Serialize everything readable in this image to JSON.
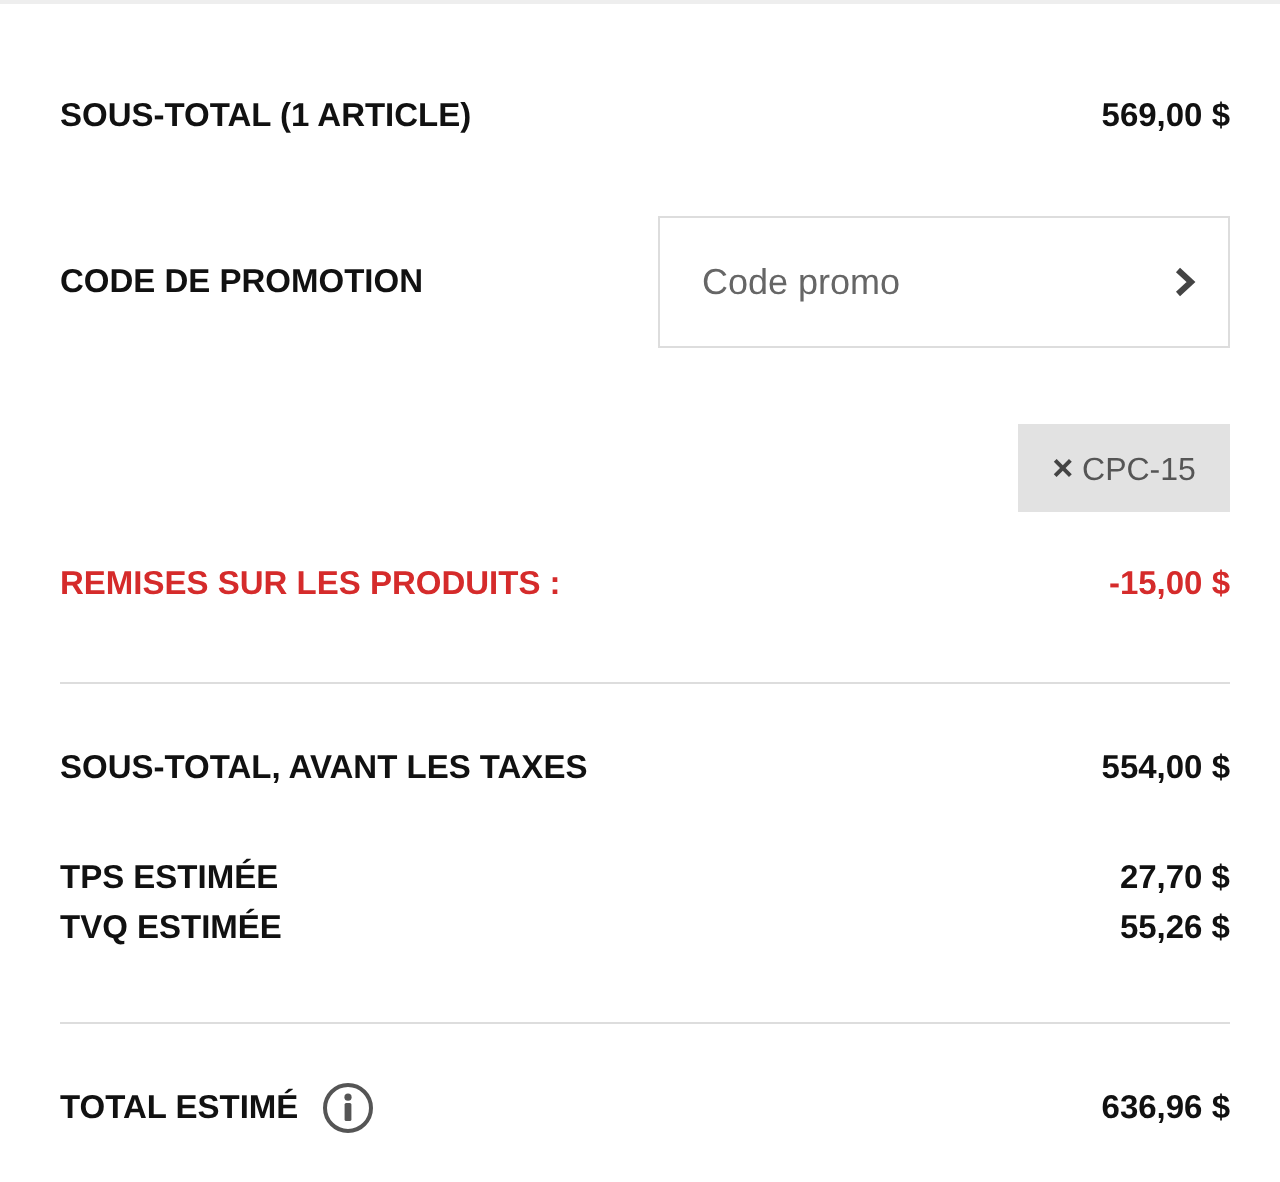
{
  "lines": [
    {
      "kind": "amount",
      "label": "SOUS-TOTAL (1 ARTICLE)",
      "value": "569,00 $"
    },
    {
      "kind": "promo",
      "label": "CODE DE PROMOTION",
      "placeholder": "Code promo"
    },
    {
      "kind": "tag",
      "remove": "×",
      "code": "CPC-15"
    },
    {
      "kind": "discount",
      "label": "REMISES SUR LES PRODUITS :",
      "value": "-15,00 $"
    },
    {
      "kind": "divider"
    },
    {
      "kind": "amount",
      "label": "SOUS-TOTAL, AVANT LES TAXES",
      "value": "554,00 $"
    },
    {
      "kind": "tax",
      "label": "TPS ESTIMÉE",
      "value": "27,70 $"
    },
    {
      "kind": "tax",
      "label": "TVQ ESTIMÉE",
      "value": "55,26 $"
    },
    {
      "kind": "divider"
    },
    {
      "kind": "total",
      "label": "TOTAL ESTIMÉ",
      "value": "636,96 $"
    }
  ]
}
